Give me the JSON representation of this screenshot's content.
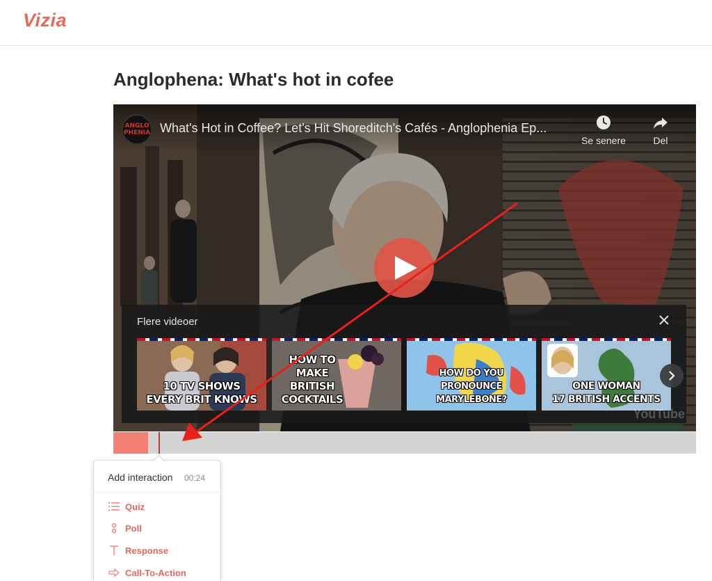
{
  "app": {
    "logo": "Vizia"
  },
  "page": {
    "title": "Anglophena: What's hot in cofee"
  },
  "player": {
    "channel_avatar_text": "ANGLO PHENIA",
    "video_title": "What's Hot in Coffee? Let's Hit Shoreditch's Cafés - Anglophenia Ep...",
    "watch_later_label": "Se senere",
    "share_label": "Del",
    "play_icon": "play-icon",
    "watermark": "YouTube",
    "more_videos": {
      "title": "Flere videoer",
      "items": [
        {
          "caption": "10 TV SHOWS\nEVERY BRIT KNOWS"
        },
        {
          "caption": "HOW TO\nMAKE\nBRITISH\nCOCKTAILS"
        },
        {
          "caption": "HOW DO YOU\nPRONOUNCE MARYLEBONE?"
        },
        {
          "caption": "ONE WOMAN\n17 BRITISH ACCENTS"
        }
      ]
    }
  },
  "timeline": {
    "progress_fraction": 0.06,
    "playhead_fraction": 0.078
  },
  "popup": {
    "title": "Add interaction",
    "time": "00:24",
    "items": [
      {
        "label": "Quiz",
        "icon": "list-icon"
      },
      {
        "label": "Poll",
        "icon": "poll-icon"
      },
      {
        "label": "Response",
        "icon": "text-icon"
      },
      {
        "label": "Call-To-Action",
        "icon": "arrow-right-icon"
      }
    ]
  },
  "colors": {
    "brand": "#e8685a",
    "progress": "#f27f72",
    "annotation_arrow": "#e8211b"
  }
}
